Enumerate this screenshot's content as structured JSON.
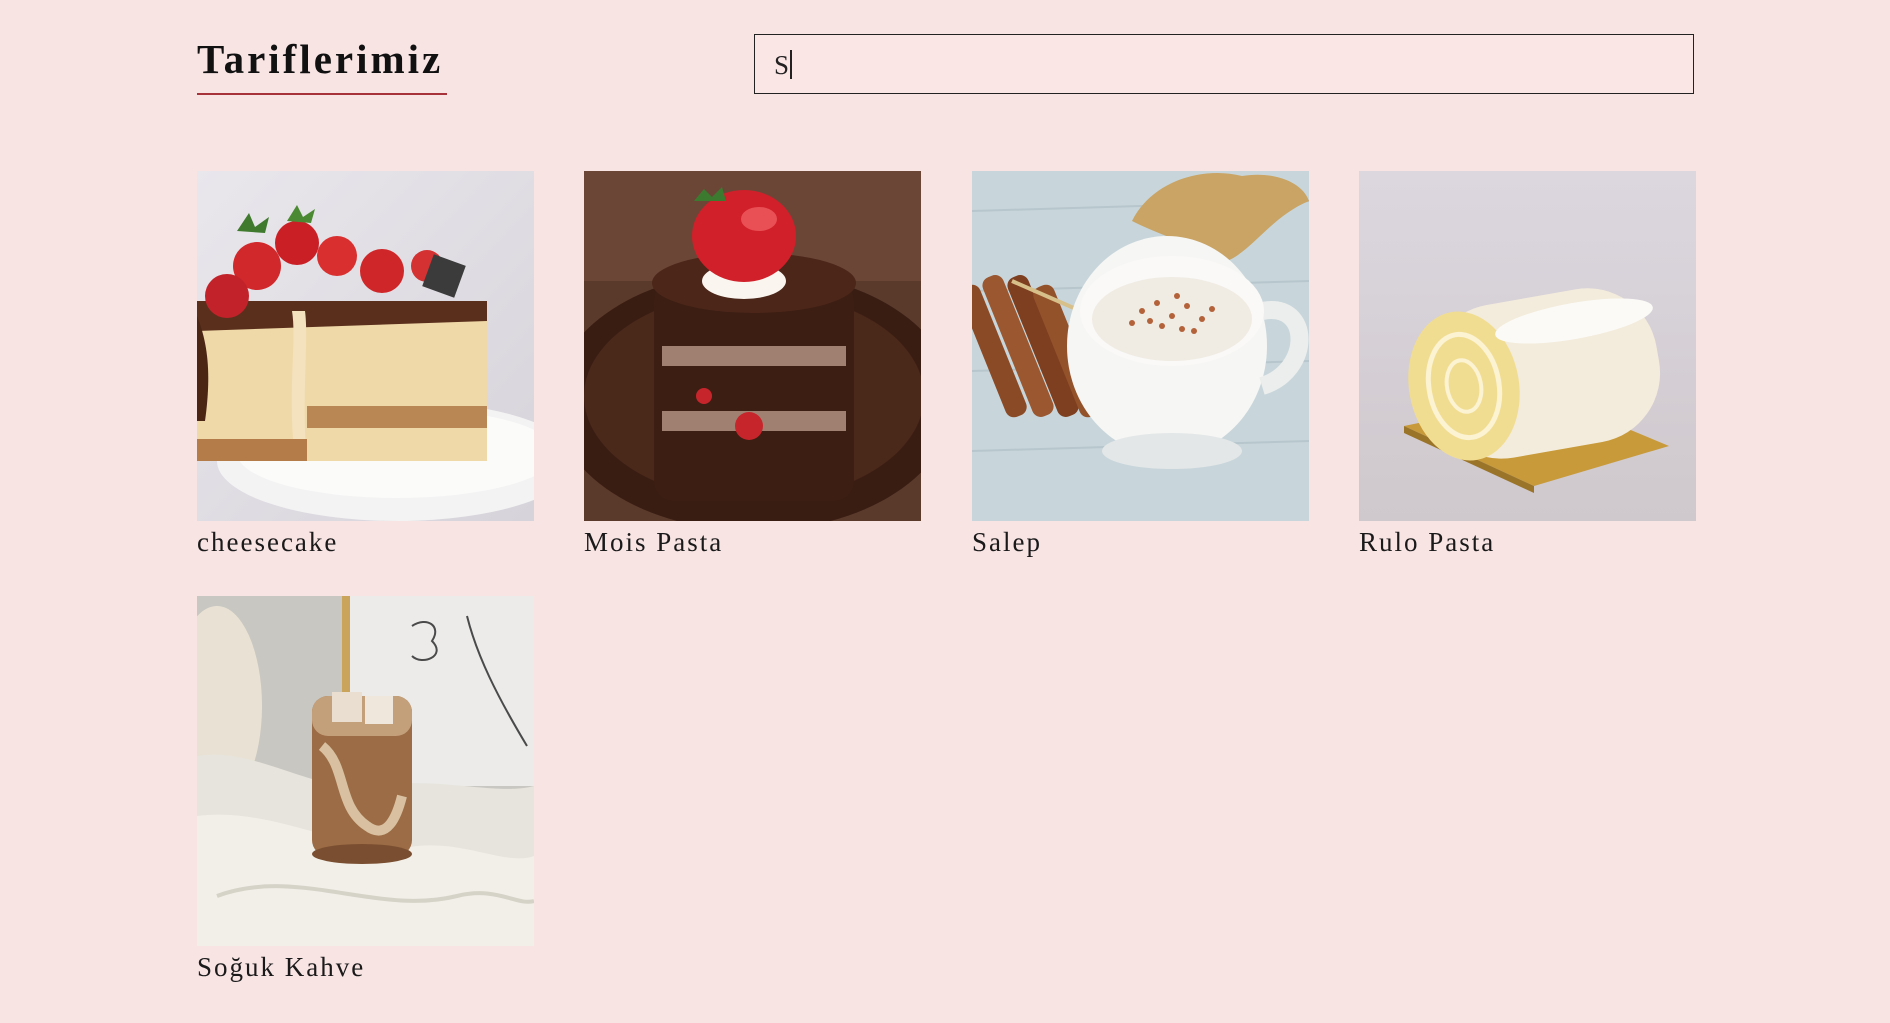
{
  "header": {
    "title": "Tariflerimiz"
  },
  "search": {
    "value": "S",
    "placeholder": ""
  },
  "recipes": [
    {
      "label": "cheesecake"
    },
    {
      "label": "Mois Pasta"
    },
    {
      "label": "Salep"
    },
    {
      "label": "Rulo Pasta"
    },
    {
      "label": "Soğuk Kahve"
    }
  ],
  "colors": {
    "background": "#f9e4e4",
    "title_underline": "#a8323a"
  }
}
